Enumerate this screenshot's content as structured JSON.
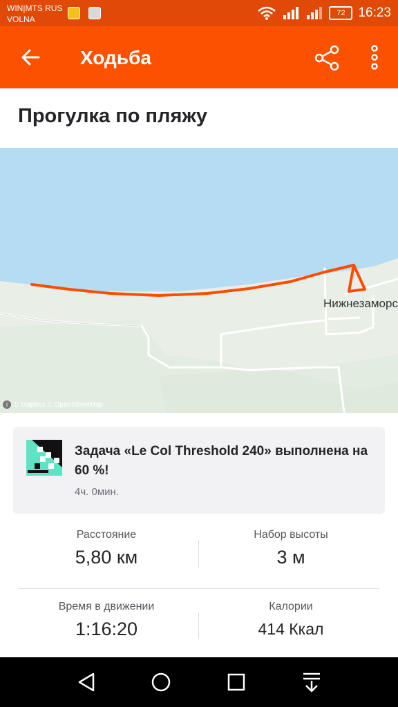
{
  "status_bar": {
    "carrier_line1": "WIN|MTS RUS",
    "carrier_line2": "VOLNA",
    "battery": "72",
    "time": "16:23"
  },
  "app_bar": {
    "title": "Ходьба",
    "icons": [
      "arrow-back-icon",
      "share-icon",
      "more-vertical-icon"
    ]
  },
  "activity": {
    "title": "Прогулка по пляжу"
  },
  "map": {
    "place_label": "Нижнезаморс",
    "attribution": "© Mapbox © OpenStreetMap",
    "colors": {
      "water": "#b5dcf3",
      "land": "#e9efe6",
      "route": "#fc4c02"
    }
  },
  "challenge": {
    "text": "Задача «Le Col Threshold 240» выполнена на 60 %!",
    "time_ago": "4ч. 0мин."
  },
  "stats": {
    "distance_label": "Расстояние",
    "distance_value": "5,80 км",
    "elevation_label": "Набор высоты",
    "elevation_value": "3 м",
    "moving_time_label": "Время в движении",
    "moving_time_value": "1:16:20",
    "calories_label": "Калории",
    "calories_value": "414 Ккал"
  },
  "colors": {
    "brand": "#fc5200",
    "status_bar": "#e04a06",
    "card_bg": "#f2f2f4"
  }
}
